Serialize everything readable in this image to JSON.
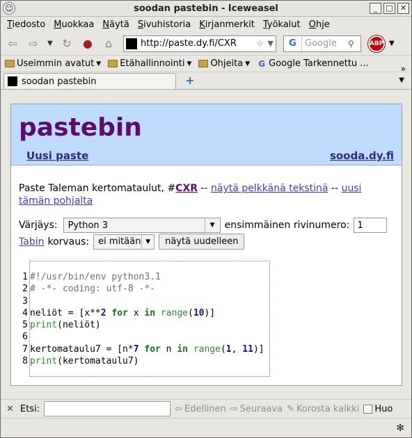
{
  "window": {
    "title": "soodan pastebin - Iceweasel"
  },
  "menu": [
    {
      "first": "T",
      "rest": "iedosto"
    },
    {
      "first": "M",
      "rest": "uokkaa"
    },
    {
      "first": "N",
      "rest": "äytä"
    },
    {
      "first": "S",
      "rest": "ivuhistoria"
    },
    {
      "first": "K",
      "rest": "irjanmerkit"
    },
    {
      "first": "T",
      "rest": "yökalut"
    },
    {
      "first": "O",
      "rest": "hje"
    }
  ],
  "nav": {
    "url": "http://paste.dy.fi/CXR",
    "search_placeholder": "Google",
    "abp": "ABP"
  },
  "bookmarks": [
    {
      "label": "Useimmin avatut",
      "icon": "rss-folder-icon"
    },
    {
      "label": "Etähallinnointi",
      "icon": "folder-icon"
    },
    {
      "label": "Ohjeita",
      "icon": "folder-icon"
    },
    {
      "label": "Google Tarkennettu ...",
      "icon": "google-icon"
    }
  ],
  "tab": {
    "title": "soodan pastebin"
  },
  "page": {
    "logo": "pastebin",
    "new_paste": "Uusi paste",
    "site_link": "sooda.dy.fi",
    "desc_prefix": "Paste Taleman kertomataulut, #",
    "paste_id": "CXR",
    "sep1": " -- ",
    "plain_link": "näytä pelkkänä tekstinä",
    "sep2": " -- ",
    "based_link": "uusi tämän pohjalta",
    "color_label": "Värjäys:",
    "color_value": "Python 3",
    "first_line_label": "ensimmäinen rivinumero:",
    "first_line_value": "1",
    "tab_link": "Tabin",
    "replace_label": "korvaus:",
    "replace_value": "ei mitään",
    "redisplay_button": "näytä uudelleen"
  },
  "code_lines": [
    "1",
    "2",
    "3",
    "4",
    "5",
    "6",
    "7",
    "8"
  ],
  "find": {
    "label": "Etsi:",
    "prev": "Edellinen",
    "next": "Seuraava",
    "highlight": "Korosta kaikki",
    "match_case": "Huo"
  }
}
